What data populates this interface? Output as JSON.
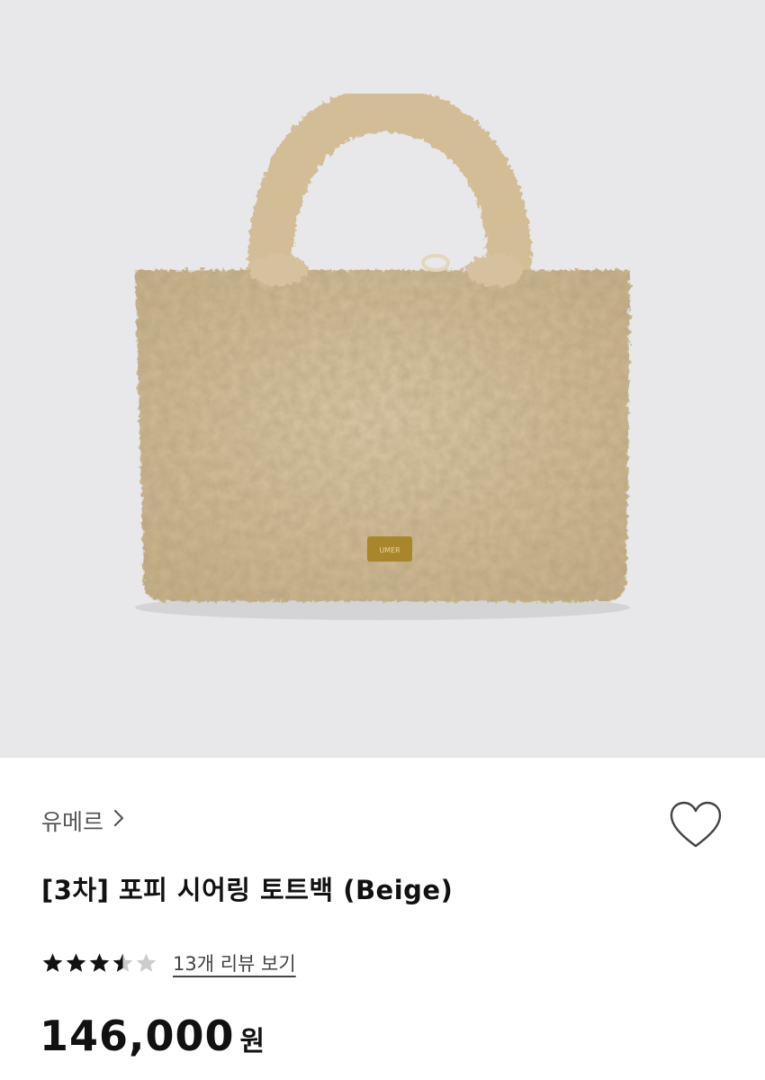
{
  "product": {
    "brand": "유메르",
    "title": "[3차] 포피 시어링 토트백 (Beige)",
    "rating": 3.5,
    "rating_max": 5,
    "review_link": "13개 리뷰 보기",
    "price": "146,000",
    "price_unit": "원",
    "logo_text": "UMER"
  },
  "icons": {
    "brand_chevron": "chevron-right-icon",
    "wishlist": "heart-outline-icon",
    "star": "star-icon"
  },
  "colors": {
    "background_hero": "#e8e8ea",
    "bag": "#d6c19c",
    "star_filled": "#111111",
    "star_empty": "#cccccc"
  }
}
